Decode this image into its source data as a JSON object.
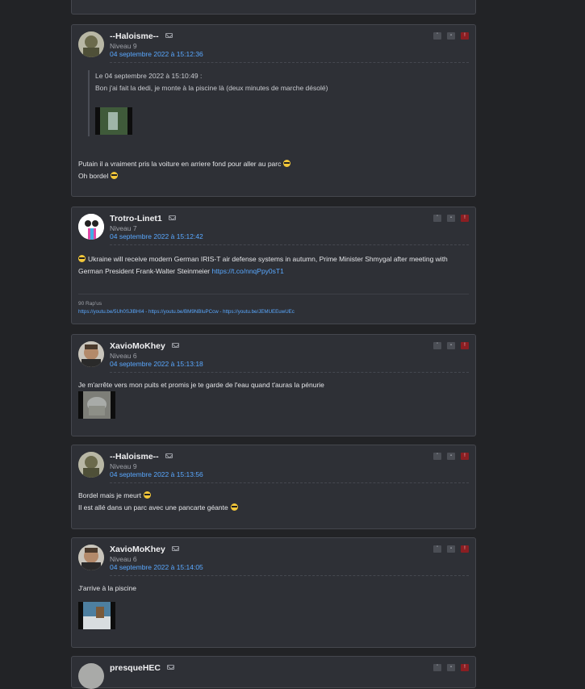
{
  "posts": [
    {
      "author": "--Haloisme--",
      "level": "Niveau 9",
      "date": "04 septembre 2022 à 15:12:36",
      "quote_header": "Le 04 septembre 2022 à 15:10:49 :",
      "quote_text": "Bon j'ai fait la dedi, je monte à la piscine là (deux minutes de marche désolé)",
      "line1": "Putain il a vraiment pris la voiture en arriere fond pour aller au parc",
      "line2": "Oh bordel"
    },
    {
      "author": "Trotro-Linet1",
      "level": "Niveau 7",
      "date": "04 septembre 2022 à 15:12:42",
      "text": "Ukraine will receive modern German IRIS-T air defense systems in autumn, Prime Minister Shmygal after meeting with German President Frank-Walter Steinmeier",
      "link": "https://t.co/nnqPpy0sT1",
      "sig_label": "90 Rap'us",
      "sig_links": "https://youtu.be/5Uh0SJIBHI4 - https://youtu.be/BM9NBIuPCcw - https://youtu.be/JEMUEEuwUEc"
    },
    {
      "author": "XavioMoKhey",
      "level": "Niveau 6",
      "date": "04 septembre 2022 à 15:13:18",
      "text": "Je m'arrête vers mon puits et promis je te garde de l'eau quand t'auras la pénurie"
    },
    {
      "author": "--Haloisme--",
      "level": "Niveau 9",
      "date": "04 septembre 2022 à 15:13:56",
      "line1": "Bordel mais je meurt",
      "line2": "Il est allé dans un parc avec une pancarte géante"
    },
    {
      "author": "XavioMoKhey",
      "level": "Niveau 6",
      "date": "04 septembre 2022 à 15:14:05",
      "text": "J'arrive à la piscine"
    },
    {
      "author": "presqueHEC"
    }
  ],
  "icons": {
    "quote": "quote-icon",
    "profile": "profile-icon",
    "alert": "alert-icon",
    "mail": "mail-icon"
  },
  "colors": {
    "background": "#222326",
    "card": "#2e3036",
    "link": "#59a8ff",
    "alert": "#8b1e22"
  }
}
